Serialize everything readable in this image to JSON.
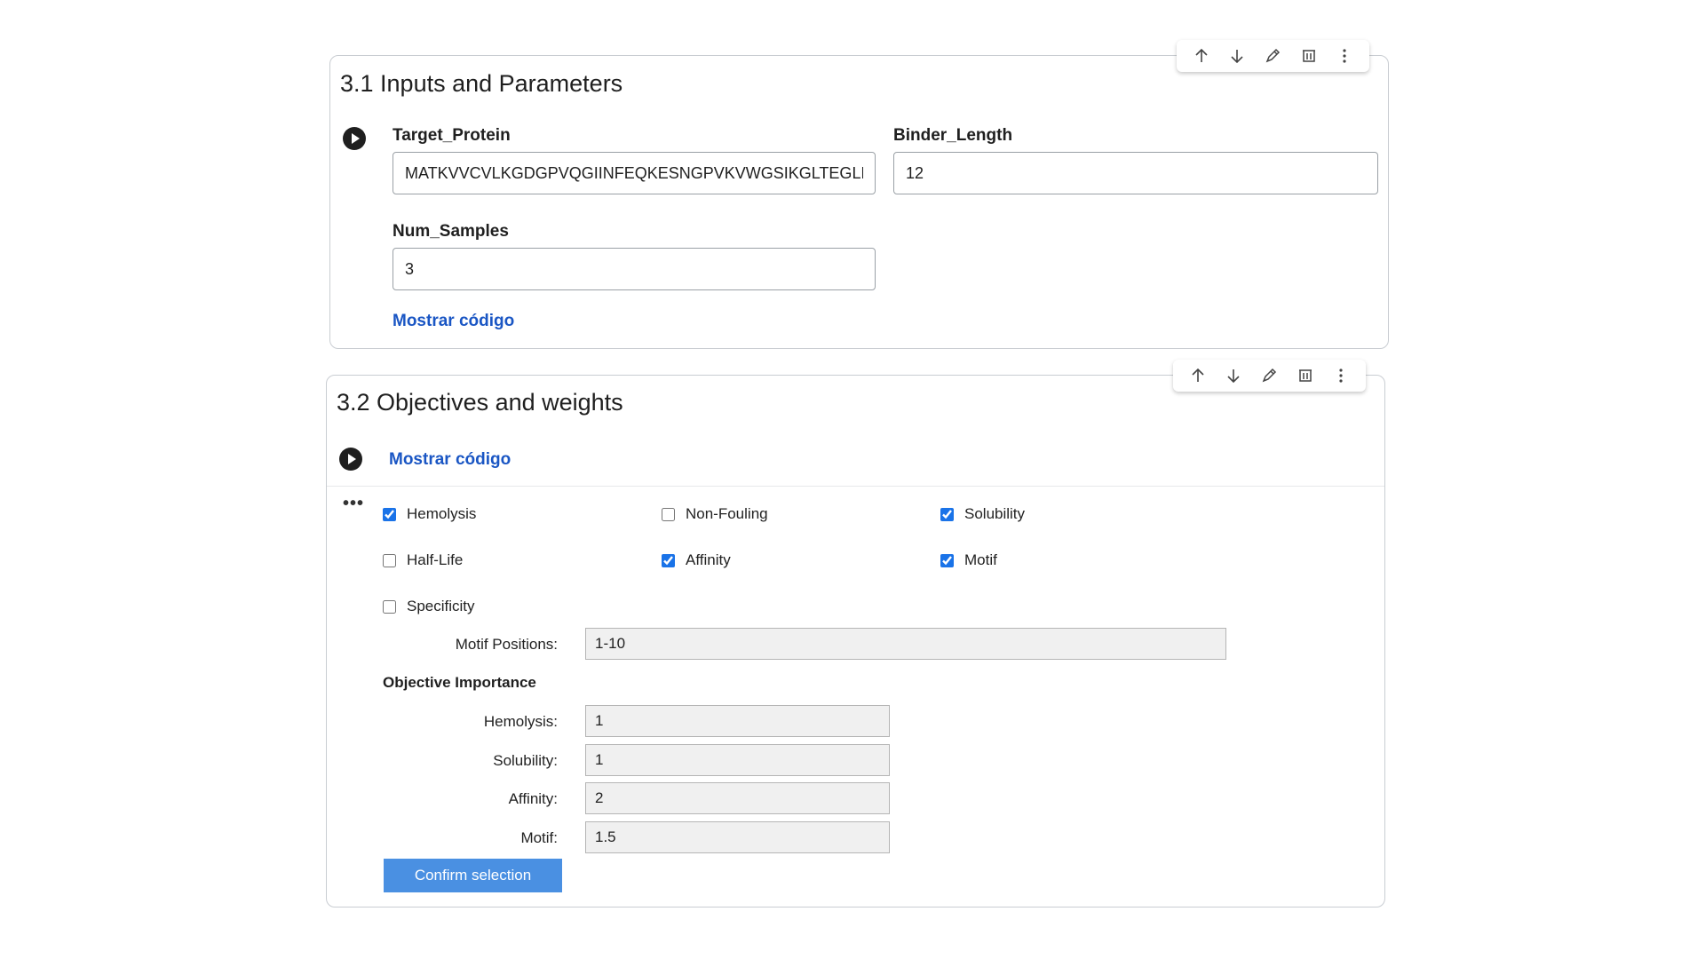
{
  "cell1": {
    "title": "3.1 Inputs and Parameters",
    "fields": {
      "target_protein": {
        "label": "Target_Protein",
        "value": "MATKVVCVLKGDGPVQGIINFEQKESNGPVKVWGSIKGLTEGLHGFHVHEFGDNTAGCTSAGPHFNPLSRKHGGPKDEERHVGDLGNVTADKDGVADVSIEDSVISLSGDHCIIGRTLVVHEKADDLGKGGNEESTKTGNAGSRLACGVIGIAQ"
      },
      "binder_length": {
        "label": "Binder_Length",
        "value": "12"
      },
      "num_samples": {
        "label": "Num_Samples",
        "value": "3"
      }
    },
    "show_code": "Mostrar código"
  },
  "cell2": {
    "title": "3.2 Objectives and weights",
    "show_code": "Mostrar código",
    "output_menu": "•••",
    "objectives": [
      {
        "label": "Hemolysis",
        "checked": true
      },
      {
        "label": "Non-Fouling",
        "checked": false
      },
      {
        "label": "Solubility",
        "checked": true
      },
      {
        "label": "Half-Life",
        "checked": false
      },
      {
        "label": "Affinity",
        "checked": true
      },
      {
        "label": "Motif",
        "checked": true
      },
      {
        "label": "Specificity",
        "checked": false
      }
    ],
    "motif_positions": {
      "label": "Motif Positions:",
      "value": "1-10"
    },
    "importance_heading": "Objective Importance",
    "weights": [
      {
        "label": "Hemolysis:",
        "value": "1"
      },
      {
        "label": "Solubility:",
        "value": "1"
      },
      {
        "label": "Affinity:",
        "value": "2"
      },
      {
        "label": "Motif:",
        "value": "1.5"
      }
    ],
    "confirm_label": "Confirm selection"
  },
  "toolbar_icons": [
    "move-up-icon",
    "move-down-icon",
    "edit-icon",
    "mirror-cell-icon",
    "more-options-icon"
  ],
  "colors": {
    "link": "#1a56c4",
    "confirm_button": "#4a90e2",
    "checkbox_accent": "#1a73e8"
  }
}
